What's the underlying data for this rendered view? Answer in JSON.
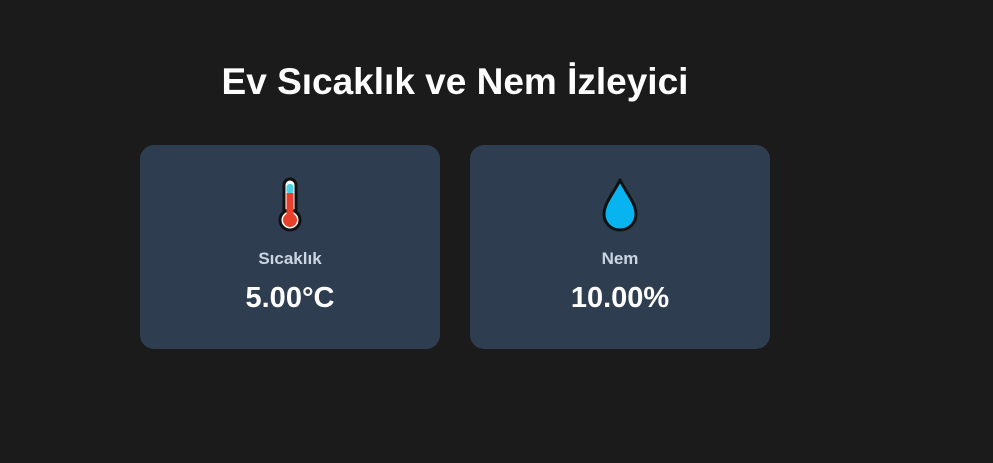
{
  "page": {
    "title": "Ev Sıcaklık ve Nem İzleyici"
  },
  "cards": {
    "temperature": {
      "icon": "thermometer-icon",
      "label": "Sıcaklık",
      "value": "5.00°C"
    },
    "humidity": {
      "icon": "water-drop-icon",
      "label": "Nem",
      "value": "10.00%"
    }
  },
  "colors": {
    "background": "#1b1b1b",
    "card": "#2e3d50",
    "label": "#cbd5e1",
    "value": "#ffffff",
    "thermometer_red": "#e8402a",
    "thermometer_cyan": "#4dd0e1",
    "drop_blue": "#08b4f0"
  }
}
